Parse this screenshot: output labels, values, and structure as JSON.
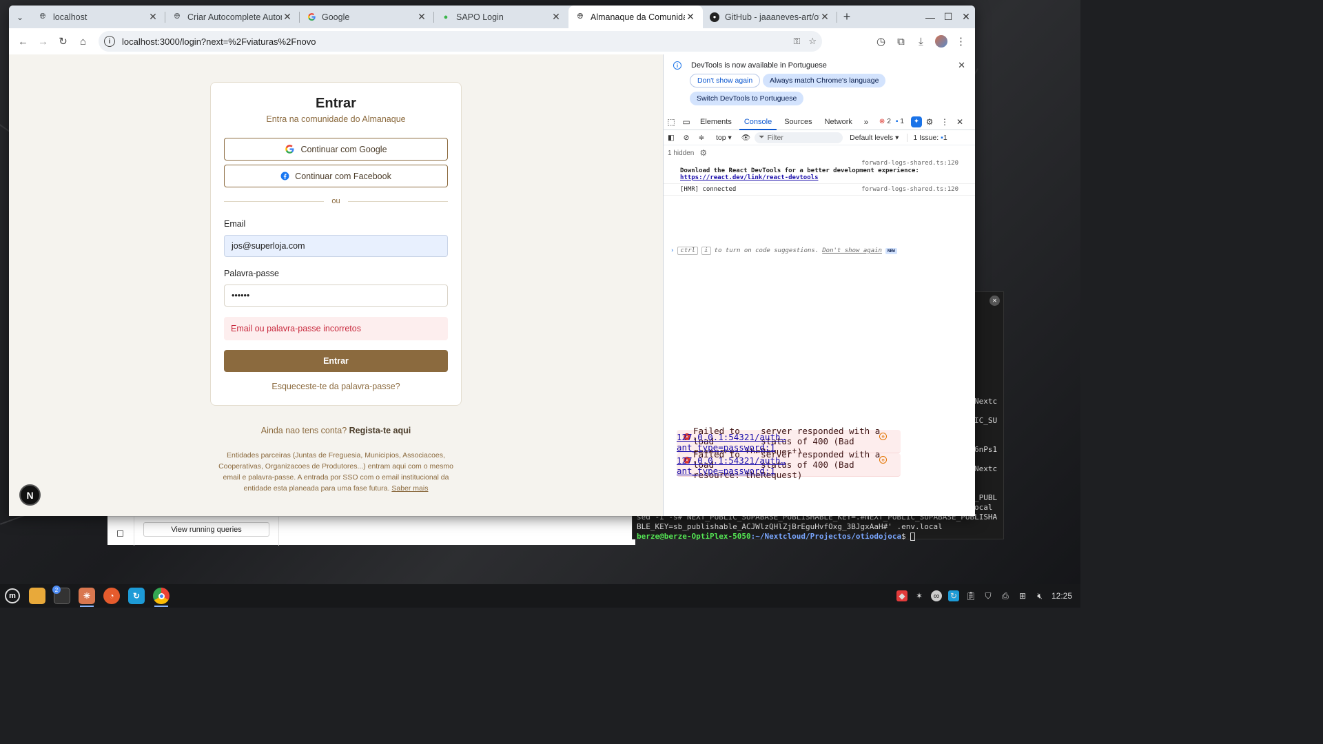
{
  "browser": {
    "tabs": [
      {
        "title": "localhost"
      },
      {
        "title": "Criar Autocomplete Automó"
      },
      {
        "title": "Google"
      },
      {
        "title": "SAPO Login"
      },
      {
        "title": "Almanaque da Comunidade"
      },
      {
        "title": "GitHub - jaaaneves-art/otiod"
      }
    ],
    "url": "localhost:3000/login?next=%2Fviaturas%2Fnovo"
  },
  "login": {
    "title": "Entrar",
    "subtitle": "Entra na comunidade do Almanaque",
    "google_button": "Continuar com Google",
    "facebook_button": "Continuar com Facebook",
    "divider": "ou",
    "email_label": "Email",
    "email_value": "jos@superloja.com",
    "password_label": "Palavra-passe",
    "password_value": "••••••",
    "error": "Email ou palavra-passe incorretos",
    "submit": "Entrar",
    "forgot": "Esqueceste-te da palavra-passe?",
    "signup_prompt": "Ainda nao tens conta?",
    "signup_link": "Regista-te aqui",
    "partners_text": "Entidades parceiras (Juntas de Freguesia, Municipios, Associacoes, Cooperativas, Organizacoes de Produtores...) entram aqui com o mesmo email e palavra-passe. A entrada por SSO com o email institucional da entidade esta planeada para uma fase futura.",
    "learn_more": "Saber mais",
    "next_badge": "N"
  },
  "devtools": {
    "banner_text": "DevTools is now available in Portuguese",
    "btn_dont_show": "Don't show again",
    "btn_match": "Always match Chrome's language",
    "btn_switch": "Switch DevTools to Portuguese",
    "tabs": [
      "Elements",
      "Console",
      "Sources",
      "Network"
    ],
    "error_count": "2",
    "msg_count": "1",
    "context": "top",
    "filter_placeholder": "Filter",
    "levels": "Default levels",
    "issues": "1 Issue:",
    "issues_count": "1",
    "hidden": "1 hidden",
    "logs": {
      "l1_src": "forward-logs-shared.ts:120",
      "l1_text": "Download the React DevTools for a better development experience:",
      "l1_link": "https://react.dev/link/react-devtools",
      "l2_text": "[HMR] connected",
      "l2_src": "forward-logs-shared.ts:120",
      "e1_text1": "Failed to load resource: the",
      "e1_text2": "server responded with a status of 400 (Bad Request)",
      "e1_src": "127.0.0.1:54321/auth…ant_type=password:1",
      "e2_text1": "Failed to load resource: the",
      "e2_text2": "server responded with a status of 400 (Bad Request)",
      "e2_src": "127.0.0.1:54321/auth…ant_type=password:1"
    },
    "prompt_key1": "ctrl",
    "prompt_key2": "i",
    "prompt_text": "to turn on code suggestions.",
    "prompt_link": "Don't show again",
    "prompt_new": "NEW"
  },
  "terminal": {
    "side": [
      "Nextc",
      "IC_SU",
      "6nPs1",
      "Nextc",
      "_PUBL",
      "ocal"
    ],
    "line1": "sed -i -s#^NEXT_PUBLIC_SUPABASE_PUBLISHABLE_KEY=.#NEXT_PUBLIC_SUPABASE_PUBLISHA",
    "line2": "BLE_KEY=sb_publishable_ACJWlzQHlZjBrEguHvfOxg_3BJgxAaH#' .env.local",
    "prompt_user": "berze@berze-OptiPlex-5050",
    "prompt_path": ":~/Nextcloud/Projectos/otiodojoca",
    "prompt_sym": "$ "
  },
  "behind_window": {
    "button": "View running queries"
  },
  "taskbar": {
    "terminal_badge": "2",
    "clock": "12:25"
  }
}
